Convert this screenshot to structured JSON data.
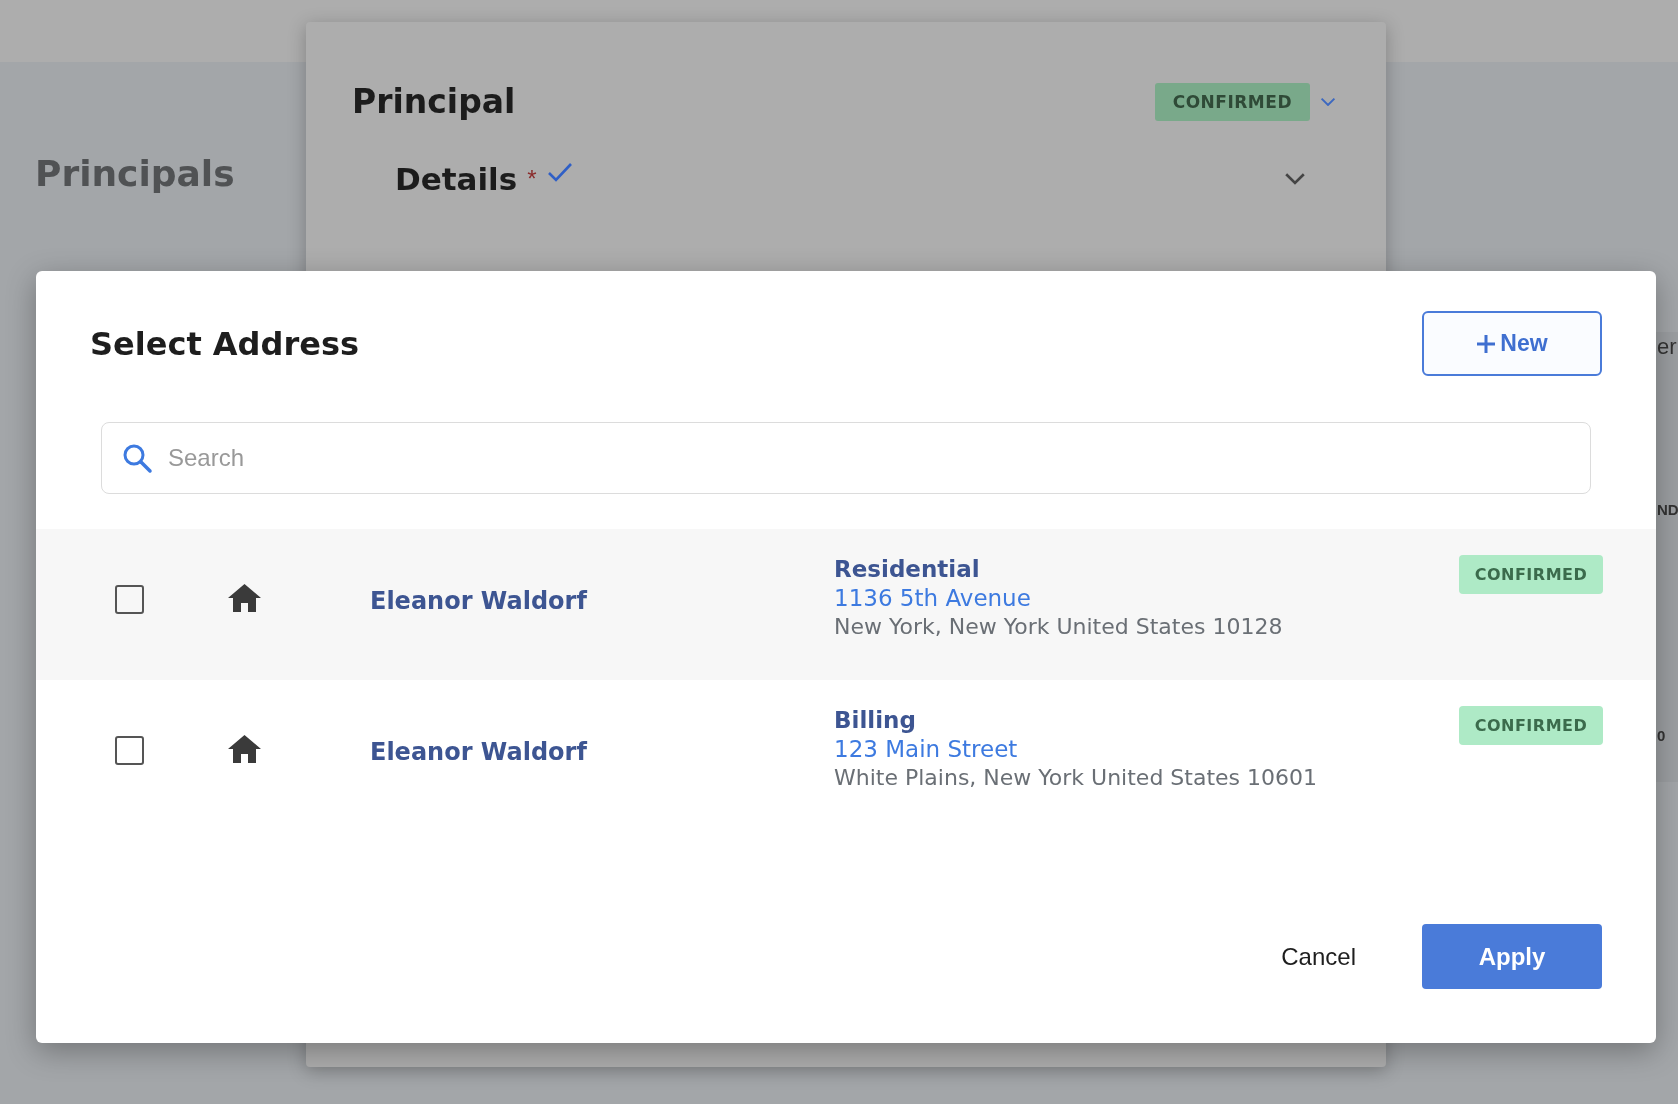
{
  "background": {
    "page_title": "Principals",
    "panel": {
      "title": "Principal",
      "status": "CONFIRMED",
      "section": {
        "title": "Details",
        "required_mark": "*",
        "complete": true
      }
    },
    "edge_texts": [
      "er",
      "ND",
      "0"
    ]
  },
  "dialog": {
    "title": "Select Address",
    "new_button": "New",
    "search": {
      "placeholder": "Search"
    },
    "rows": [
      {
        "checked": false,
        "name": "Eleanor Waldorf",
        "type": "Residential",
        "street": "1136 5th Avenue",
        "city": "New York, New York United States 10128",
        "status": "CONFIRMED"
      },
      {
        "checked": false,
        "name": "Eleanor Waldorf",
        "type": "Billing",
        "street": "123 Main Street",
        "city": "White Plains, New York United States 10601",
        "status": "CONFIRMED"
      }
    ],
    "buttons": {
      "cancel": "Cancel",
      "apply": "Apply"
    }
  }
}
